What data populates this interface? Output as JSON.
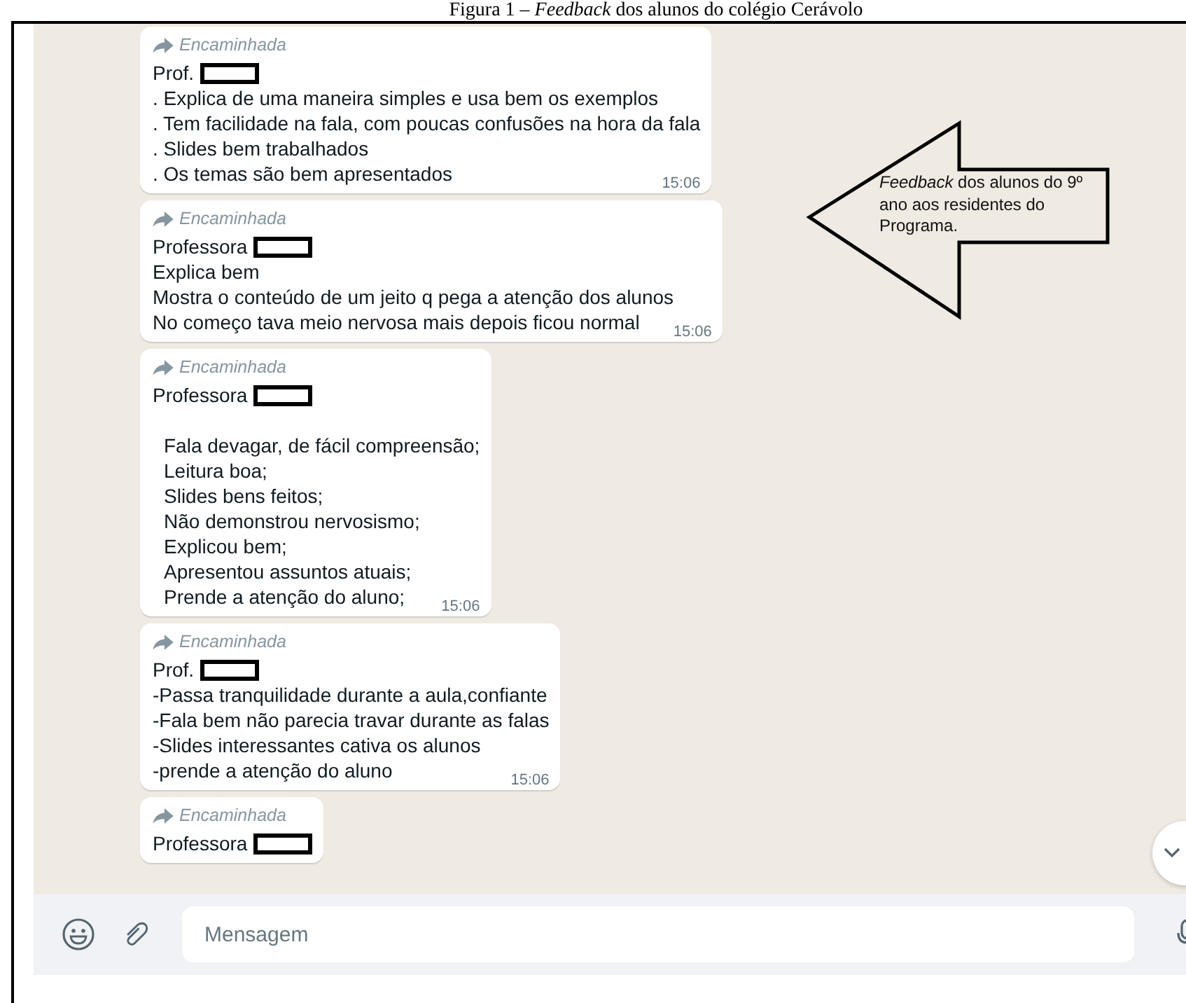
{
  "caption": "Figura 1 – *Feedback* dos alunos do colégio Cerávolo",
  "messages": [
    {
      "forwarded_label": "Encaminhada",
      "heading": "Prof.",
      "redacted": true,
      "kind": "plain",
      "lines": [
        ". Explica de uma maneira simples e usa bem os exemplos",
        ". Tem facilidade na fala, com poucas confusões na hora da fala",
        ". Slides bem trabalhados",
        ". Os temas são bem apresentados"
      ],
      "time": "15:06"
    },
    {
      "forwarded_label": "Encaminhada",
      "heading": "Professora",
      "redacted": true,
      "kind": "plain",
      "lines": [
        "Explica bem",
        "Mostra o conteúdo de um jeito q pega a atenção dos alunos",
        "No começo tava meio nervosa mais depois ficou normal"
      ],
      "time": "15:06"
    },
    {
      "forwarded_label": "Encaminhada",
      "heading": "Professora",
      "redacted": true,
      "kind": "spaced",
      "lines": [
        "Fala devagar, de fácil compreensão;",
        "Leitura boa;",
        "Slides bens feitos;",
        "Não demonstrou nervosismo;",
        "Explicou bem;",
        "Apresentou assuntos atuais;",
        "Prende a atenção do aluno;"
      ],
      "time": "15:06"
    },
    {
      "forwarded_label": "Encaminhada",
      "heading": "Prof.",
      "redacted": true,
      "kind": "plain",
      "lines": [
        "-Passa tranquilidade durante a aula,confiante",
        "-Fala bem não parecia travar durante as falas",
        "-Slides interessantes cativa os alunos",
        "-prende a atenção do aluno"
      ],
      "time": "15:06"
    },
    {
      "forwarded_label": "Encaminhada",
      "heading": "Professora",
      "redacted": true,
      "kind": "plain"
    }
  ],
  "callout": {
    "text": "*Feedback* dos alunos do 9º ano aos residentes do Programa."
  },
  "composer": {
    "placeholder": "Mensagem"
  }
}
